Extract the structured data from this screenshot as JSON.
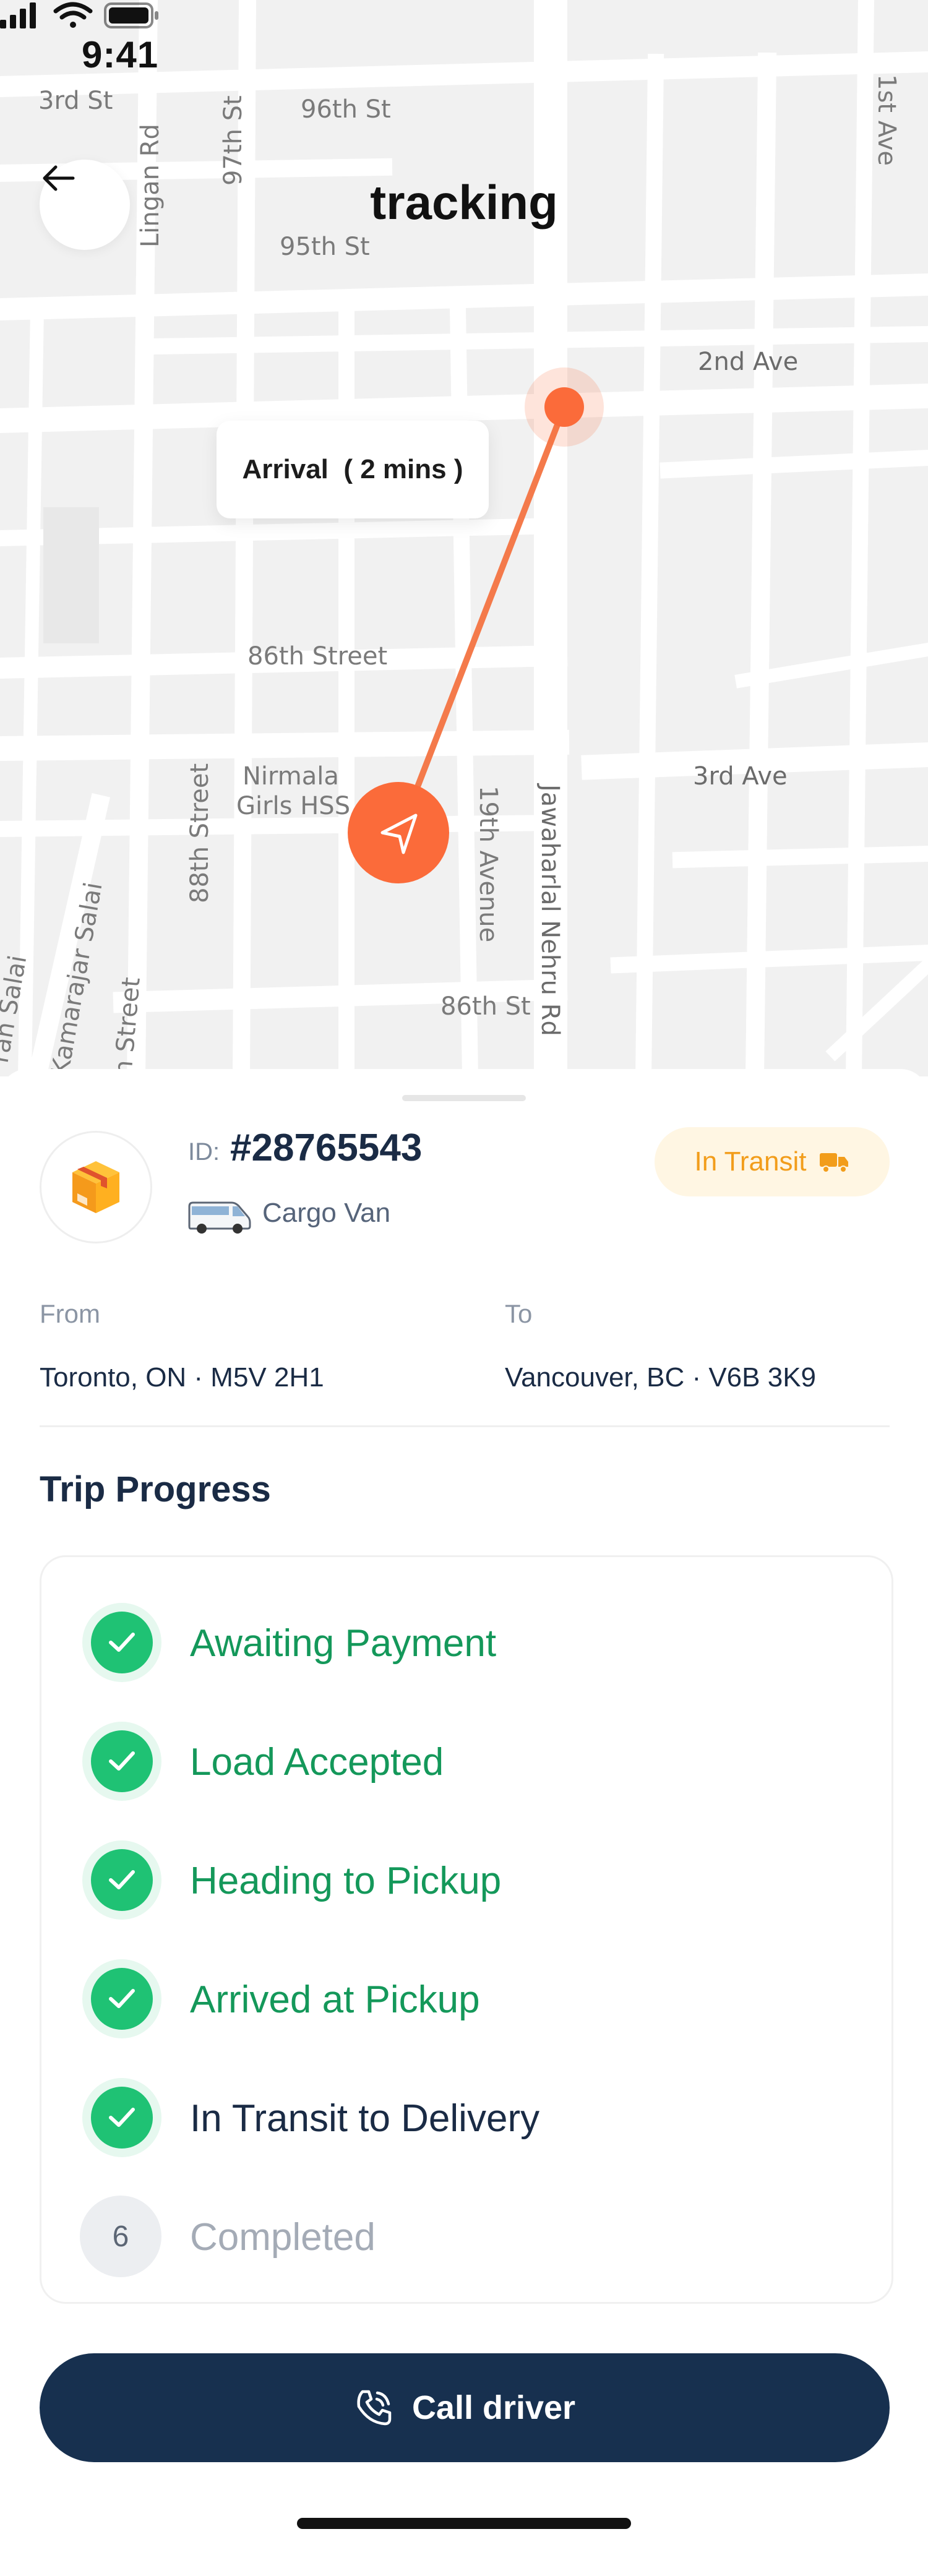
{
  "status_bar": {
    "time": "9:41"
  },
  "header": {
    "title": "tracking"
  },
  "map": {
    "arrival_label": "Arrival  ( 2 mins )",
    "streets": {
      "s3rd": "3rd St",
      "s96th": "96th St",
      "s97th": "97th St",
      "lingan": "Lingan Rd",
      "s95th": "95th St",
      "ave1st": "1st Ave",
      "ave2nd": "2nd Ave",
      "street86": "86th Street",
      "nirmala1": "Nirmala",
      "nirmala2": "Girls HSS",
      "street88": "88th Street",
      "ave19": "19th Avenue",
      "jawaharlal": "Jawaharlal Nehru Rd",
      "ave3rd": "3rd Ave",
      "kamarajar": "Kamarajar Salai",
      "stlower": "n Street",
      "salai_edge": "ran Salai",
      "st86": "86th St"
    },
    "colors": {
      "route": "#f47a4b",
      "marker": "#fb6b3a"
    }
  },
  "shipment": {
    "id_prefix": "ID:",
    "id": "#28765543",
    "vehicle": "Cargo Van",
    "status": "In Transit",
    "status_color": "#f29d1b",
    "from_label": "From",
    "from": "Toronto, ON · M5V 2H1",
    "to_label": "To",
    "to": "Vancouver, BC · V6B 3K9"
  },
  "progress": {
    "title": "Trip Progress",
    "steps": [
      {
        "label": "Awaiting Payment",
        "state": "done"
      },
      {
        "label": "Load Accepted",
        "state": "done"
      },
      {
        "label": "Heading to Pickup",
        "state": "done"
      },
      {
        "label": "Arrived at Pickup",
        "state": "done"
      },
      {
        "label": "In Transit to Delivery",
        "state": "current"
      },
      {
        "label": "Completed",
        "state": "todo",
        "number": "6"
      }
    ],
    "colors": {
      "done": "#1fc274",
      "done_text": "#14985a"
    }
  },
  "actions": {
    "call_label": "Call driver"
  }
}
